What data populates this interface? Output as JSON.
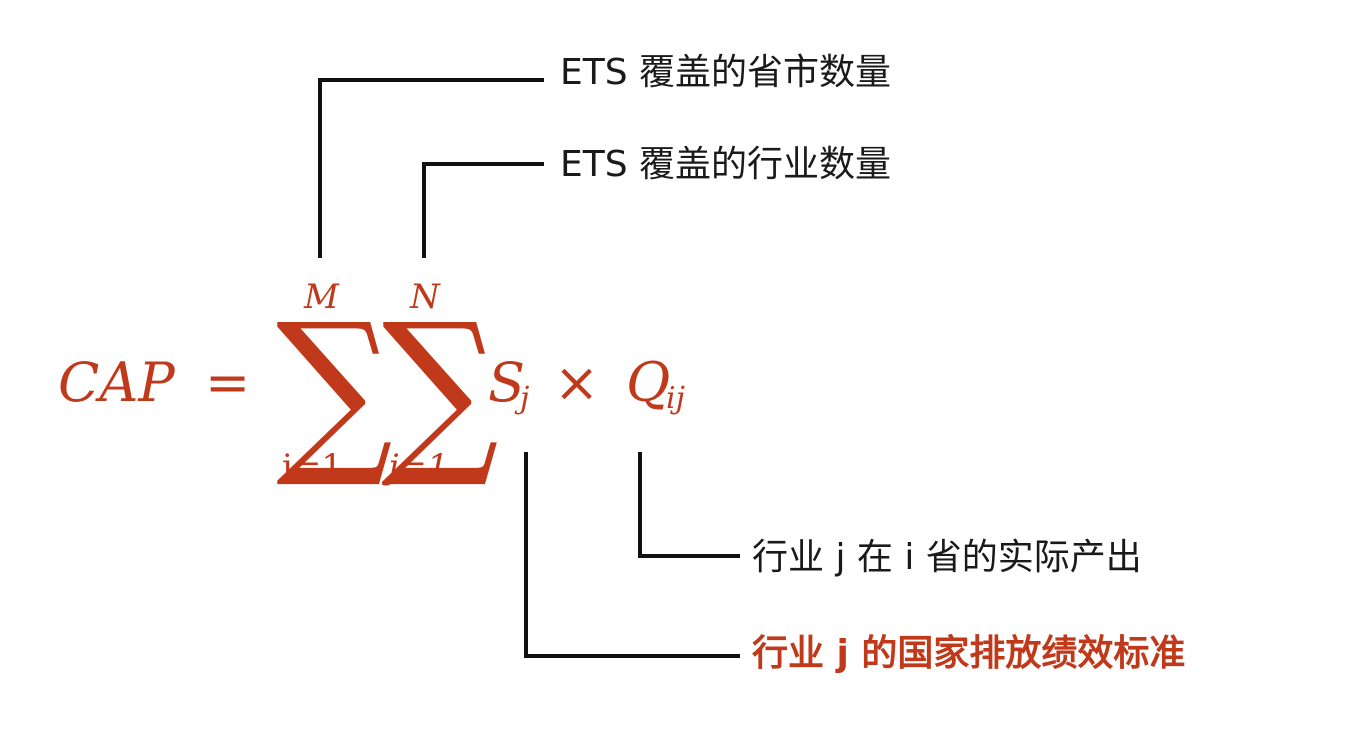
{
  "formula": {
    "lhs": "CAP",
    "equals": "=",
    "sum1": {
      "symbol": "∑",
      "upper": "M",
      "lower": "i=1"
    },
    "sum2": {
      "symbol": "∑",
      "upper": "N",
      "lower": "j=1"
    },
    "s_term": {
      "base": "S",
      "sub": "j"
    },
    "times": "×",
    "q_term": {
      "base": "Q",
      "sub": "ij"
    }
  },
  "labels": {
    "provinces": "ETS 覆盖的省市数量",
    "industries": "ETS 覆盖的行业数量",
    "actual_output": "行业 j 在 i 省的实际产出",
    "emission_standard": "行业 j 的国家排放绩效标准"
  },
  "colors": {
    "formula": "#c0391b",
    "text": "#1a1a1a",
    "connector": "#111111",
    "highlight": "#c0391b"
  }
}
